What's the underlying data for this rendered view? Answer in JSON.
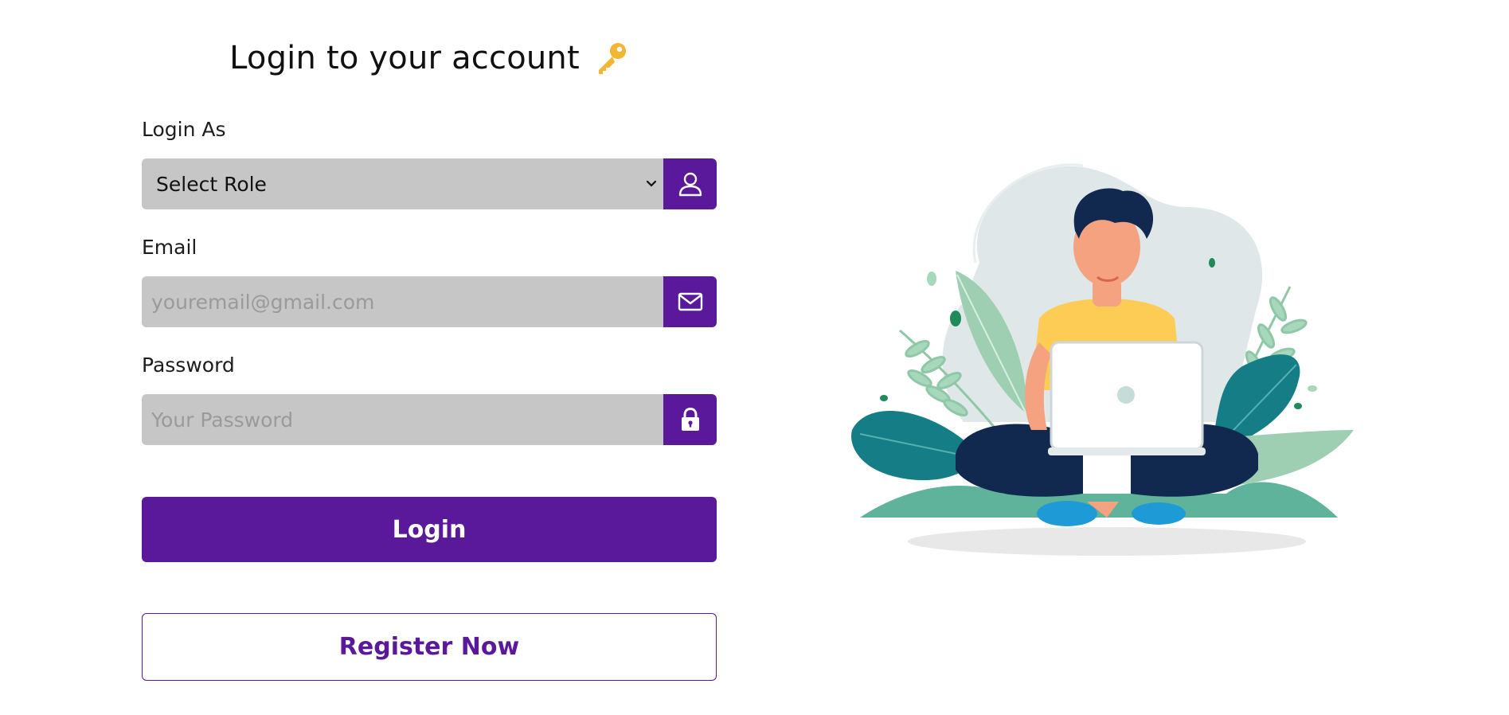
{
  "login_form": {
    "title": "Login to your account",
    "title_icon": "key-icon",
    "role": {
      "label": "Login As",
      "selected_value": "Select Role",
      "icon": "user-icon"
    },
    "email": {
      "label": "Email",
      "placeholder": "youremail@gmail.com",
      "value": "",
      "icon": "envelope-icon"
    },
    "password": {
      "label": "Password",
      "placeholder": "Your Password",
      "value": "",
      "icon": "lock-icon"
    },
    "login_button_label": "Login",
    "register_button_label": "Register Now"
  },
  "illustration": {
    "icon": "person-with-laptop-illustration"
  },
  "colors": {
    "accent": "#5a189a",
    "input_background": "#c6c6c6",
    "key_gold": "#f2b632"
  }
}
